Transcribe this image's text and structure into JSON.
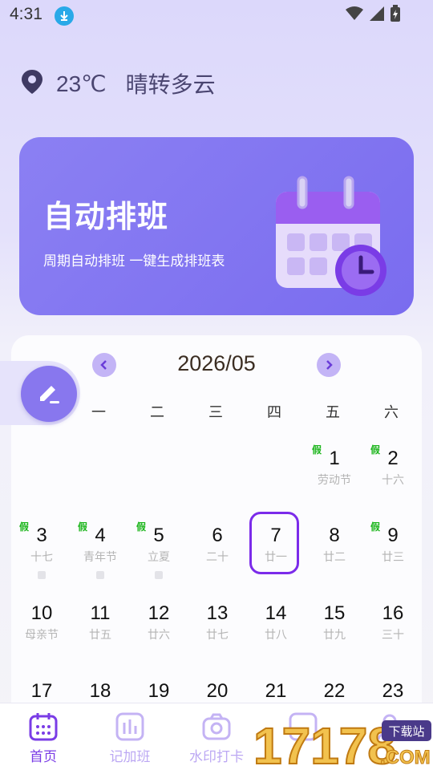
{
  "status": {
    "time": "4:31"
  },
  "weather": {
    "temperature": "23℃",
    "condition": "晴转多云"
  },
  "banner": {
    "title": "自动排班",
    "subtitle": "周期自动排班 一键生成排班表"
  },
  "calendar": {
    "month": "2026/05",
    "weekdays": [
      "一",
      "二",
      "三",
      "四",
      "五",
      "六"
    ],
    "holiday_tag": "假",
    "rows": [
      [
        {
          "num": "1",
          "sub": "劳动节",
          "holiday": true
        },
        {
          "num": "2",
          "sub": "十六",
          "holiday": true
        }
      ],
      [
        {
          "num": "3",
          "sub": "十七",
          "holiday": true
        },
        {
          "num": "4",
          "sub": "青年节",
          "holiday": true
        },
        {
          "num": "5",
          "sub": "立夏",
          "holiday": true
        },
        {
          "num": "6",
          "sub": "二十"
        },
        {
          "num": "7",
          "sub": "廿一",
          "today": true
        },
        {
          "num": "8",
          "sub": "廿二"
        },
        {
          "num": "9",
          "sub": "廿三",
          "holiday": true
        }
      ],
      [
        {
          "num": "10",
          "sub": "母亲节"
        },
        {
          "num": "11",
          "sub": "廿五"
        },
        {
          "num": "12",
          "sub": "廿六"
        },
        {
          "num": "13",
          "sub": "廿七"
        },
        {
          "num": "14",
          "sub": "廿八"
        },
        {
          "num": "15",
          "sub": "廿九"
        },
        {
          "num": "16",
          "sub": "三十"
        }
      ],
      [
        {
          "num": "17",
          "sub": ""
        },
        {
          "num": "18",
          "sub": ""
        },
        {
          "num": "19",
          "sub": ""
        },
        {
          "num": "20",
          "sub": ""
        },
        {
          "num": "21",
          "sub": ""
        },
        {
          "num": "22",
          "sub": ""
        },
        {
          "num": "23",
          "sub": ""
        }
      ]
    ]
  },
  "tabs": [
    {
      "label": "首页",
      "icon": "calendar-icon",
      "active": true
    },
    {
      "label": "记加班",
      "icon": "chart-icon"
    },
    {
      "label": "水印打卡",
      "icon": "camera-icon"
    },
    {
      "label": "",
      "icon": "list-icon"
    },
    {
      "label": "",
      "icon": "user-icon"
    }
  ],
  "watermark": {
    "text": "17178",
    "badge": "下载站",
    "suffix": ".COM"
  },
  "colors": {
    "accent": "#7a3ce6",
    "banner": "#8b80f3",
    "holiday": "#1bb51b"
  }
}
